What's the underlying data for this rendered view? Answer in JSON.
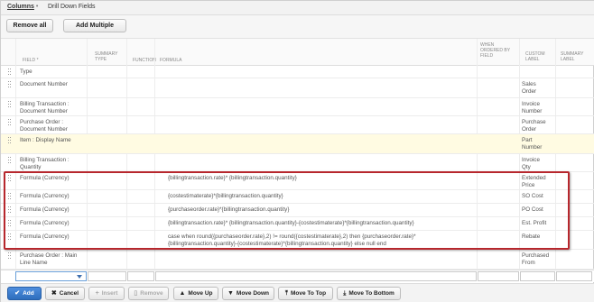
{
  "tabs": {
    "columns": "Columns",
    "columns_marker": "•",
    "drill_down": "Drill Down Fields"
  },
  "toolbar": {
    "remove_all": "Remove all",
    "add_multiple": "Add Multiple"
  },
  "headers": {
    "field": "FIELD",
    "field_marker": "*",
    "summary_type_1": "SUMMARY",
    "summary_type_2": "TYPE",
    "function": "FUNCTION",
    "formula": "FORMULA",
    "when_ordered_1": "WHEN",
    "when_ordered_2": "ORDERED BY",
    "when_ordered_3": "FIELD",
    "custom_label_1": "CUSTOM",
    "custom_label_2": "LABEL",
    "summary_label_1": "SUMMARY",
    "summary_label_2": "LABEL"
  },
  "rows": [
    {
      "field1": "Type",
      "field2": "",
      "formula1": "",
      "formula2": "",
      "label1": "",
      "label2": ""
    },
    {
      "field1": "Document Number",
      "field2": "",
      "formula1": "",
      "formula2": "",
      "label1": "Sales",
      "label2": "Order"
    },
    {
      "field1": "Billing Transaction :",
      "field2": "Document Number",
      "formula1": "",
      "formula2": "",
      "label1": "Invoice",
      "label2": "Number"
    },
    {
      "field1": "Purchase Order :",
      "field2": "Document Number",
      "formula1": "",
      "formula2": "",
      "label1": "Purchase",
      "label2": "Order"
    },
    {
      "field1": "Item : Display Name",
      "field2": "",
      "formula1": "",
      "formula2": "",
      "label1": "Part",
      "label2": "Number"
    },
    {
      "field1": "Billing Transaction :",
      "field2": "Quantity",
      "formula1": "",
      "formula2": "",
      "label1": "Invoice",
      "label2": "Qty"
    },
    {
      "field1": "Formula (Currency)",
      "field2": "",
      "formula1": "{billingtransaction.rate}* {billingtransaction.quantity}",
      "formula2": "",
      "label1": "Extended",
      "label2": "Price"
    },
    {
      "field1": "Formula (Currency)",
      "field2": "",
      "formula1": "{costestimaterate}*{billingtransaction.quantity}",
      "formula2": "",
      "label1": "SO Cost",
      "label2": ""
    },
    {
      "field1": "Formula (Currency)",
      "field2": "",
      "formula1": "{purchaseorder.rate}*{billingtransaction.quantity}",
      "formula2": "",
      "label1": "PO Cost",
      "label2": ""
    },
    {
      "field1": "Formula (Currency)",
      "field2": "",
      "formula1": "{billingtransaction.rate}* {billingtransaction.quantity}-{costestimaterate}*{billingtransaction.quantity}",
      "formula2": "",
      "label1": "Est. Profit",
      "label2": ""
    },
    {
      "field1": "Formula (Currency)",
      "field2": "",
      "formula1": "case when round({purchaseorder.rate},2) != round({costestimaterate},2) then {purchaseorder.rate}*",
      "formula2": "{billingtransaction.quantity}-{costestimaterate}*{billingtransaction.quantity} else null end",
      "label1": "Rebate",
      "label2": ""
    },
    {
      "field1": "Purchase Order : Main",
      "field2": "Line Name",
      "formula1": "",
      "formula2": "",
      "label1": "Purchased",
      "label2": "From"
    }
  ],
  "actions": {
    "add": "Add",
    "cancel": "Cancel",
    "insert": "Insert",
    "remove": "Remove",
    "move_up": "Move Up",
    "move_down": "Move Down",
    "move_to_top": "Move To Top",
    "move_to_bottom": "Move To Bottom"
  },
  "icons": {
    "add": "check-icon",
    "cancel": "close-icon",
    "insert": "plus-icon",
    "remove": "trash-icon",
    "move_up": "arrow-up-icon",
    "move_down": "arrow-down-icon",
    "move_to_top": "arrow-top-icon",
    "move_to_bottom": "arrow-bottom-icon"
  },
  "colors": {
    "highlight_row": "#fffbe2",
    "callout_border": "#b7272d",
    "primary_button": "#2e6ebd"
  }
}
